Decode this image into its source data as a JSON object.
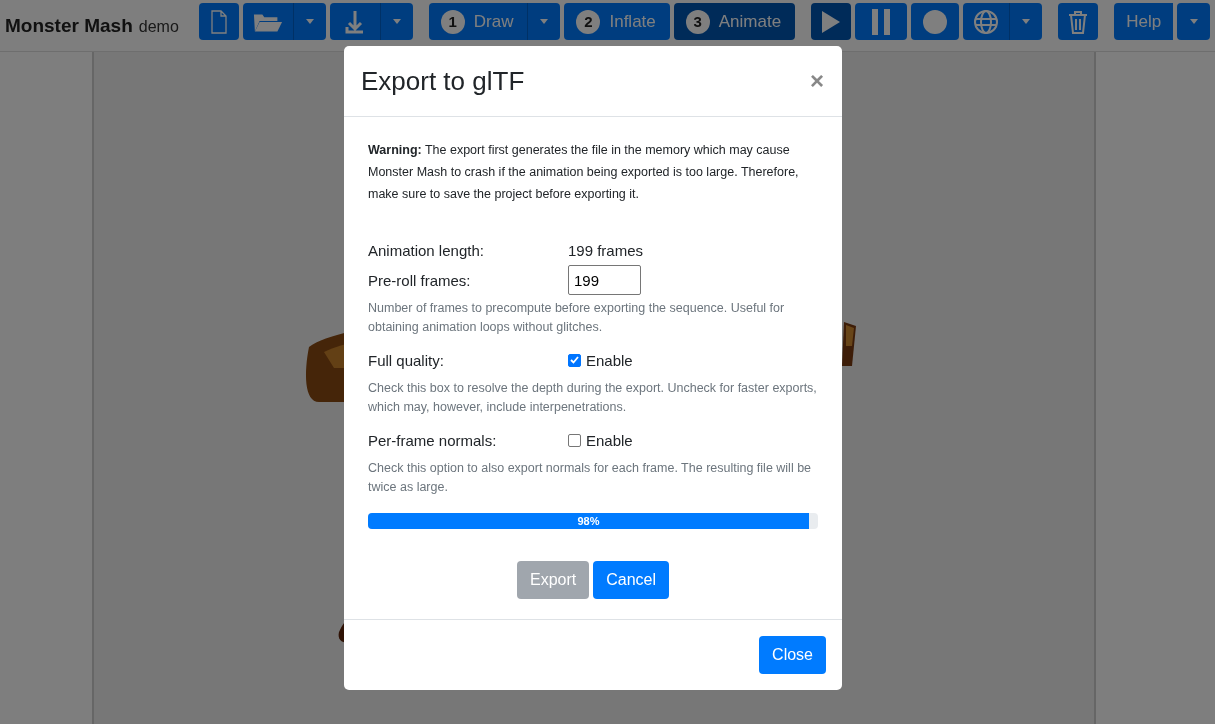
{
  "app": {
    "title": "Monster Mash",
    "subtitle": "demo"
  },
  "toolbar": {
    "steps": [
      {
        "number": "1",
        "label": "Draw",
        "selected": false,
        "has_menu": true
      },
      {
        "number": "2",
        "label": "Inflate",
        "selected": false,
        "has_menu": false
      },
      {
        "number": "3",
        "label": "Animate",
        "selected": true,
        "has_menu": false
      }
    ],
    "help": "Help"
  },
  "dialog": {
    "title": "Export to glTF",
    "close": "×",
    "warning": "**Warning:** The export first generates the file in the memory which may cause Monster Mash to crash if the animation being exported is too large. Therefore, make sure to save the project before exporting it.",
    "fields": [
      {
        "kind": "text",
        "label": "Animation length:",
        "value": "199 frames"
      },
      {
        "kind": "input",
        "label": "Pre-roll frames:",
        "value": "199",
        "hint": "Number of frames to precompute before exporting the sequence. Useful for obtaining animation loops without glitches."
      },
      {
        "kind": "checkbox",
        "label": "Full quality:",
        "option": "Enable",
        "checked": true,
        "hint": "Check this box to resolve the depth during the export. Uncheck for faster exports, which may, however, include interpenetrations."
      },
      {
        "kind": "checkbox",
        "label": "Per-frame normals:",
        "option": "Enable",
        "checked": false,
        "hint": "Check this option to also export normals for each frame. The resulting file will be twice as large."
      }
    ],
    "progress": {
      "level": 0.98,
      "text": "98%"
    },
    "buttons": [
      {
        "label": "Export",
        "disabled": true
      },
      {
        "label": "Cancel",
        "disabled": false
      }
    ],
    "footer_button": "Close"
  }
}
